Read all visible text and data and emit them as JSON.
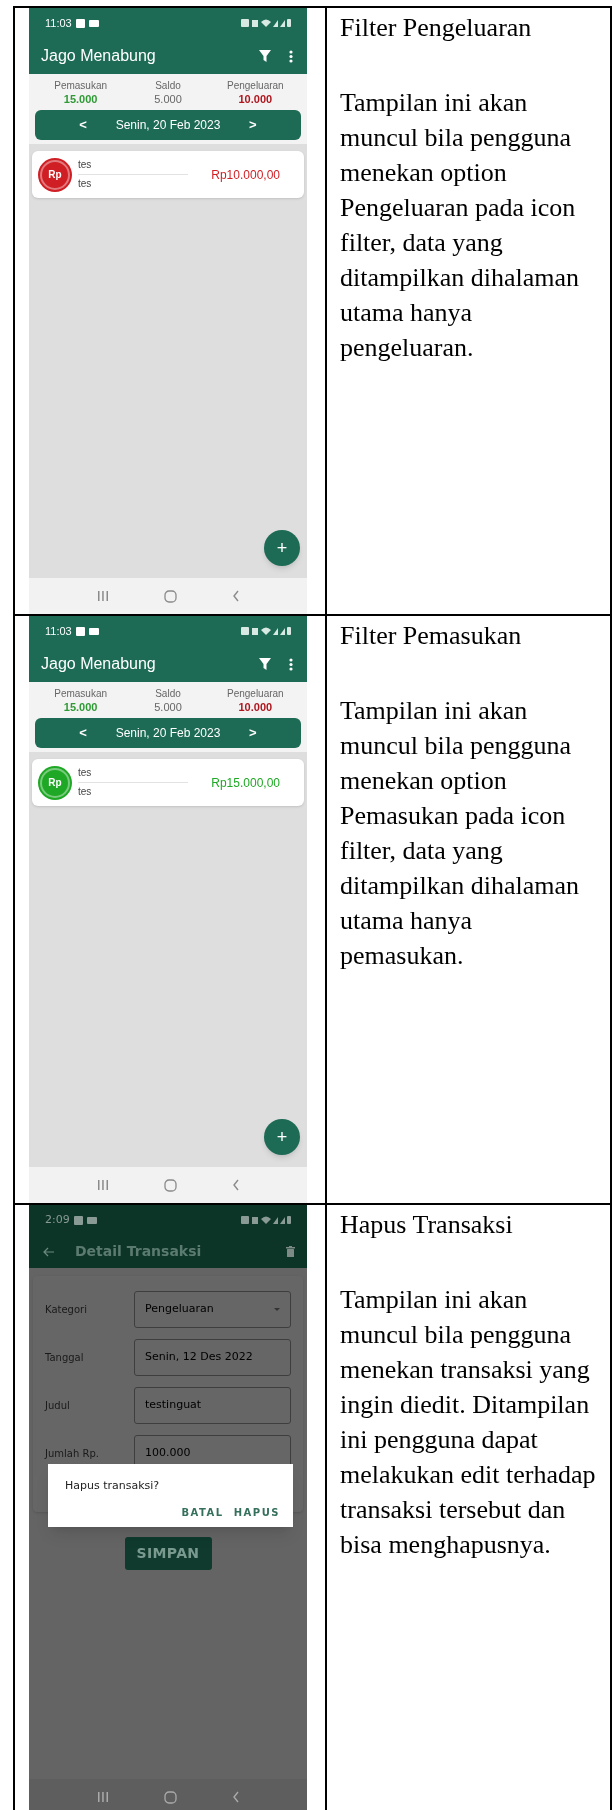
{
  "rows": [
    {
      "title": "Filter Pengeluaran",
      "description": "Tampilan ini akan muncul bila pengguna menekan option Pengeluaran pada icon filter, data yang ditampilkan dihalaman utama hanya pengeluaran.",
      "phone": {
        "kind": "home",
        "status_time": "11:03",
        "app_title": "Jago Menabung",
        "summary": [
          {
            "label": "Pemasukan",
            "value": "15.000",
            "color": "#2f9a35"
          },
          {
            "label": "Saldo",
            "value": "5.000",
            "color": "#666666"
          },
          {
            "label": "Pengeluaran",
            "value": "10.000",
            "color": "#b0161e"
          }
        ],
        "date_nav": {
          "prev": "<",
          "date": "Senin, 20 Feb 2023",
          "next": ">"
        },
        "transactions": [
          {
            "badge": "Rp",
            "title": "tes",
            "subtitle": "tes",
            "amount": "Rp10.000,00",
            "color": "#cf1f24"
          }
        ],
        "fab": "+"
      }
    },
    {
      "title": "Filter Pemasukan",
      "description": "Tampilan ini akan muncul bila pengguna menekan option Pemasukan pada icon filter, data yang ditampilkan dihalaman utama hanya pemasukan.",
      "phone": {
        "kind": "home",
        "status_time": "11:03",
        "app_title": "Jago Menabung",
        "summary": [
          {
            "label": "Pemasukan",
            "value": "15.000",
            "color": "#2f9a35"
          },
          {
            "label": "Saldo",
            "value": "5.000",
            "color": "#666666"
          },
          {
            "label": "Pengeluaran",
            "value": "10.000",
            "color": "#b0161e"
          }
        ],
        "date_nav": {
          "prev": "<",
          "date": "Senin, 20 Feb 2023",
          "next": ">"
        },
        "transactions": [
          {
            "badge": "Rp",
            "title": "tes",
            "subtitle": "tes",
            "amount": "Rp15.000,00",
            "color": "#1fa825"
          }
        ],
        "fab": "+"
      }
    },
    {
      "title": "Hapus Transaksi",
      "description": "Tampilan ini akan muncul bila pengguna menekan transaksi yang ingin diedit. Ditampilan ini pengguna dapat melakukan edit terhadap transaksi tersebut dan bisa menghapusnya.",
      "phone": {
        "kind": "detail",
        "status_time": "2:09",
        "app_title": "Detail Transaksi",
        "fields": [
          {
            "label": "Kategori",
            "value": "Pengeluaran",
            "kind": "dropdown"
          },
          {
            "label": "Tanggal",
            "value": "Senin, 12 Des 2022",
            "kind": "text"
          },
          {
            "label": "Judul",
            "value": "testinguat",
            "kind": "text"
          },
          {
            "label": "Jumlah Rp.",
            "value": "100.000",
            "kind": "text"
          }
        ],
        "dialog": {
          "message": "Hapus transaksi?",
          "buttons": [
            "BATAL",
            "HAPUS"
          ]
        },
        "save_button": "SIMPAN"
      }
    }
  ]
}
